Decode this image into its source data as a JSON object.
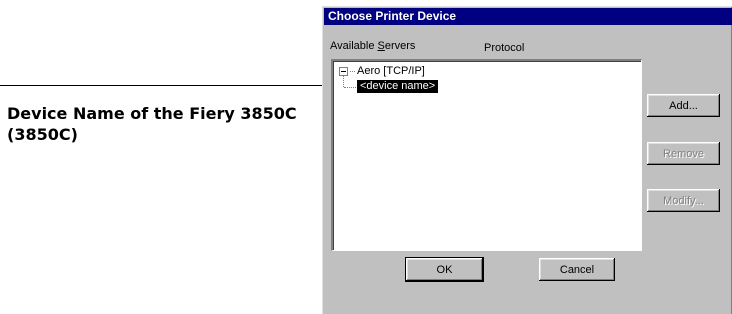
{
  "callout": {
    "line1": "Device Name of the Fiery 3850C",
    "line2": "(3850C)"
  },
  "dialog": {
    "title": "Choose Printer Device",
    "available_servers_prefix": "Available ",
    "available_servers_underlined": "S",
    "available_servers_suffix": "ervers",
    "protocol_label": "Protocol",
    "tree": {
      "root_label": "Aero [TCP/IP]",
      "child_label": "<device name>",
      "root_expanded": true
    },
    "buttons": {
      "add": "Add...",
      "remove": "Remove",
      "modify": "Modify...",
      "ok": "OK",
      "cancel": "Cancel"
    }
  },
  "colors": {
    "titlebar": "#000080",
    "dialog_face": "#c0c0c0",
    "selection": "#000000"
  }
}
